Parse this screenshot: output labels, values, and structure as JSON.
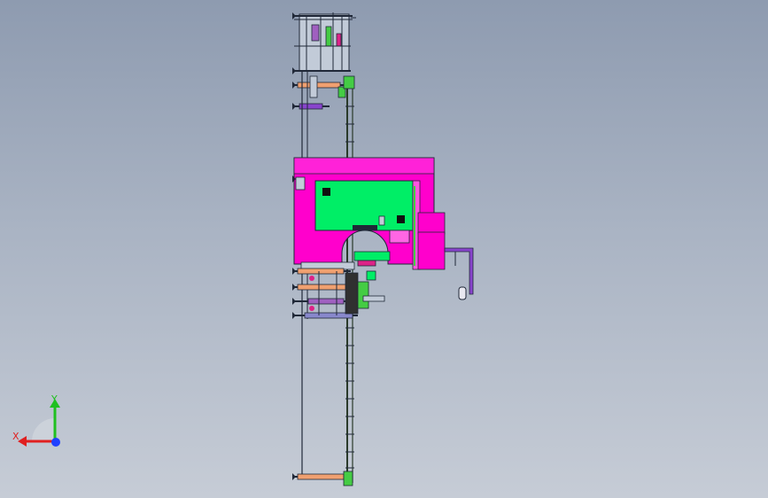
{
  "viewport": {
    "background_top": "#8e9bb0",
    "background_bottom": "#c6ccd6"
  },
  "model": {
    "colors": {
      "frame": "#c2cbd8",
      "outline": "#202838",
      "housing": "#ff00cc",
      "panel": "#00ee66",
      "bracket": "#8844cc",
      "rail": "#2a3a2a",
      "accent_orange": "#f0a070",
      "accent_purple": "#a060c0",
      "accent_green": "#44cc44"
    }
  },
  "triad": {
    "x_label": "X",
    "y_label": "Y",
    "x_color": "#e02020",
    "y_color": "#20c020",
    "z_color": "#2040ff"
  }
}
